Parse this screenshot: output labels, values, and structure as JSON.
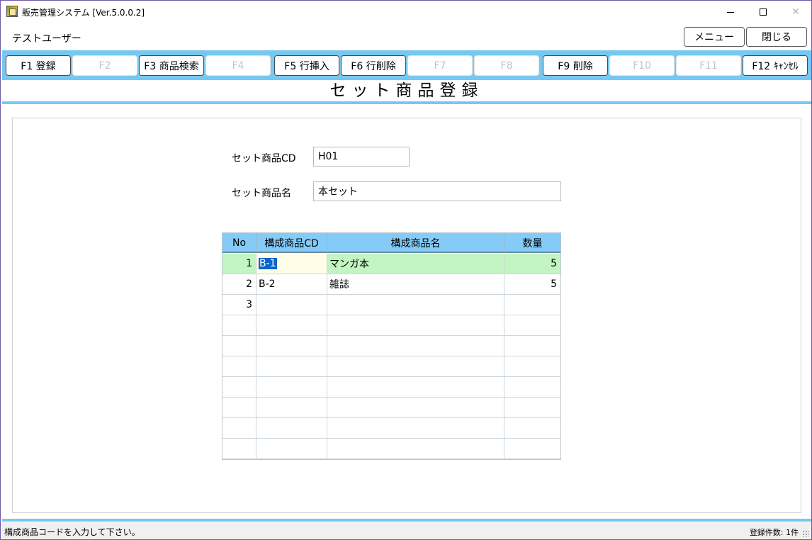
{
  "window": {
    "title": "販売管理システム [Ver.5.0.0.2]",
    "minimize_symbol": "",
    "close_symbol": "✕"
  },
  "user": {
    "name": "テストユーザー"
  },
  "top_buttons": {
    "menu": "メニュー",
    "close": "閉じる"
  },
  "fkeys": [
    {
      "label": "F1 登録",
      "enabled": true
    },
    {
      "label": "F2",
      "enabled": false
    },
    {
      "label": "F3 商品検索",
      "enabled": true
    },
    {
      "label": "F4",
      "enabled": false
    },
    {
      "label": "F5 行挿入",
      "enabled": true
    },
    {
      "label": "F6 行削除",
      "enabled": true
    },
    {
      "label": "F7",
      "enabled": false
    },
    {
      "label": "F8",
      "enabled": false
    },
    {
      "label": "F9 削除",
      "enabled": true
    },
    {
      "label": "F10",
      "enabled": false
    },
    {
      "label": "F11",
      "enabled": false
    },
    {
      "label": "F12 ｷｬﾝｾﾙ",
      "enabled": true
    }
  ],
  "screen_title": "セット商品登録",
  "form": {
    "set_cd_label": "セット商品CD",
    "set_cd_value": "H01",
    "set_name_label": "セット商品名",
    "set_name_value": "本セット"
  },
  "grid": {
    "headers": [
      "No",
      "構成商品CD",
      "構成商品名",
      "数量"
    ],
    "rows": [
      {
        "no": "1",
        "cd": "B-1",
        "name": "マンガ本",
        "qty": "5"
      },
      {
        "no": "2",
        "cd": "B-2",
        "name": "雑誌",
        "qty": "5"
      },
      {
        "no": "3",
        "cd": "",
        "name": "",
        "qty": ""
      },
      {
        "no": "",
        "cd": "",
        "name": "",
        "qty": ""
      },
      {
        "no": "",
        "cd": "",
        "name": "",
        "qty": ""
      },
      {
        "no": "",
        "cd": "",
        "name": "",
        "qty": ""
      },
      {
        "no": "",
        "cd": "",
        "name": "",
        "qty": ""
      },
      {
        "no": "",
        "cd": "",
        "name": "",
        "qty": ""
      },
      {
        "no": "",
        "cd": "",
        "name": "",
        "qty": ""
      },
      {
        "no": "",
        "cd": "",
        "name": "",
        "qty": ""
      }
    ]
  },
  "status": {
    "message": "構成商品コードを入力して下さい。",
    "record_count": "登録件数: 1件"
  },
  "colors": {
    "accent": "#76c8f2",
    "grid_header": "#85cbf7",
    "active_row": "#c2f5c2",
    "selection": "#0a64c8"
  }
}
